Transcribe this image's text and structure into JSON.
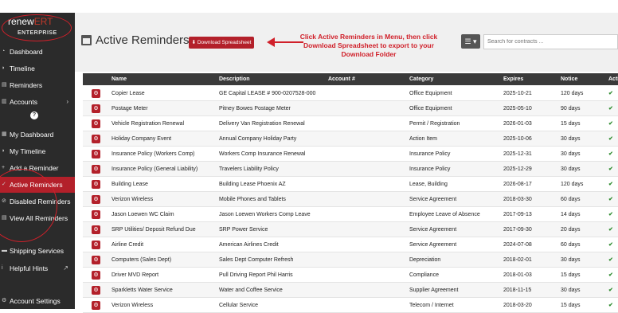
{
  "brand": {
    "logo_main": "renew",
    "logo_dim": "ERT",
    "subtitle": "ENTERPRISE"
  },
  "sidebar": {
    "items": [
      {
        "label": "Dashboard",
        "icon": "tachometer-icon"
      },
      {
        "label": "Timeline",
        "icon": "timeline-icon"
      },
      {
        "label": "Reminders",
        "icon": "list-icon"
      },
      {
        "label": "Accounts",
        "icon": "book-icon"
      },
      {
        "label": "My Dashboard",
        "icon": "tachometer-icon"
      },
      {
        "label": "My Timeline",
        "icon": "timeline-icon"
      },
      {
        "label": "Add a Reminder",
        "icon": "plus-icon"
      },
      {
        "label": "Active Reminders",
        "icon": "check-icon"
      },
      {
        "label": "Disabled Reminders",
        "icon": "ban-icon"
      },
      {
        "label": "View All Reminders",
        "icon": "list-icon"
      },
      {
        "label": "Shipping Services",
        "icon": "truck-icon"
      },
      {
        "label": "Helpful Hints",
        "icon": "info-icon"
      },
      {
        "label": "Account Settings",
        "icon": "gear-icon"
      }
    ],
    "help_glyph": "?"
  },
  "header": {
    "title": "Active Reminders",
    "download_label": "⬇ Download Spreadsheet",
    "annotation": "Click Active Reminders in Menu, then click Download Spreadsheet to export to your Download Folder",
    "menu_glyph": "☰ ▾",
    "search_placeholder": "Search for contracts ..."
  },
  "table": {
    "columns": [
      "Name",
      "Description",
      "Account #",
      "Category",
      "Expires",
      "Notice",
      "Active"
    ],
    "rows": [
      {
        "name": "Copier Lease",
        "desc": "GE Capital LEASE # 900-0207528-000",
        "acct": "",
        "cat": "Office Equipment",
        "exp": "2025-10-21",
        "notice": "120 days"
      },
      {
        "name": "Postage Meter",
        "desc": "Pitney Bowes Postage Meter",
        "acct": "",
        "cat": "Office Equipment",
        "exp": "2025-05-10",
        "notice": "90 days"
      },
      {
        "name": "Vehicle Registration Renewal",
        "desc": "Delivery Van Registration Renewal",
        "acct": "",
        "cat": "Permit / Registration",
        "exp": "2026-01-03",
        "notice": "15 days"
      },
      {
        "name": "Holiday Company Event",
        "desc": "Annual Company Holiday Party",
        "acct": "",
        "cat": "Action Item",
        "exp": "2025-10-06",
        "notice": "30 days"
      },
      {
        "name": "Insurance Policy (Workers Comp)",
        "desc": "Workers Comp Insurance Renewal",
        "acct": "",
        "cat": "Insurance Policy",
        "exp": "2025-12-31",
        "notice": "30 days"
      },
      {
        "name": "Insurance Policy (General Liability)",
        "desc": "Travelers Liability Policy",
        "acct": "",
        "cat": "Insurance Policy",
        "exp": "2025-12-29",
        "notice": "30 days"
      },
      {
        "name": "Building Lease",
        "desc": "Building Lease Phoenix AZ",
        "acct": "",
        "cat": "Lease, Building",
        "exp": "2026-08-17",
        "notice": "120 days"
      },
      {
        "name": "Verizon Wireless",
        "desc": "Mobile Phones and Tablets",
        "acct": "",
        "cat": "Service Agreement",
        "exp": "2018-03-30",
        "notice": "60 days"
      },
      {
        "name": "Jason Loewen WC Claim",
        "desc": "Jason Loewen Workers Comp Leave",
        "acct": "",
        "cat": "Employee Leave of Absence",
        "exp": "2017-09-13",
        "notice": "14 days"
      },
      {
        "name": "SRP Utilities/ Deposit Refund Due",
        "desc": "SRP Power Service",
        "acct": "",
        "cat": "Service Agreement",
        "exp": "2017-09-30",
        "notice": "20 days"
      },
      {
        "name": "Airline Credit",
        "desc": "American Airlines Credit",
        "acct": "",
        "cat": "Service Agreement",
        "exp": "2024-07-08",
        "notice": "60 days"
      },
      {
        "name": "Computers (Sales Dept)",
        "desc": "Sales Dept Computer Refresh",
        "acct": "",
        "cat": "Depreciation",
        "exp": "2018-02-01",
        "notice": "30 days"
      },
      {
        "name": "Driver MVD Report",
        "desc": "Pull Driving Report Phil Harris",
        "acct": "",
        "cat": "Compliance",
        "exp": "2018-01-03",
        "notice": "15 days"
      },
      {
        "name": "Sparkletts Water Service",
        "desc": "Water and Coffee Service",
        "acct": "",
        "cat": "Supplier Agreement",
        "exp": "2018-11-15",
        "notice": "30 days"
      },
      {
        "name": "Verizon Wireless",
        "desc": "Cellular Service",
        "acct": "",
        "cat": "Telecom / Internet",
        "exp": "2018-03-20",
        "notice": "15 days"
      }
    ]
  },
  "colors": {
    "accent": "#b3202a",
    "sidebar_bg": "#2b2b2b",
    "active_check": "#2e8b2e"
  }
}
